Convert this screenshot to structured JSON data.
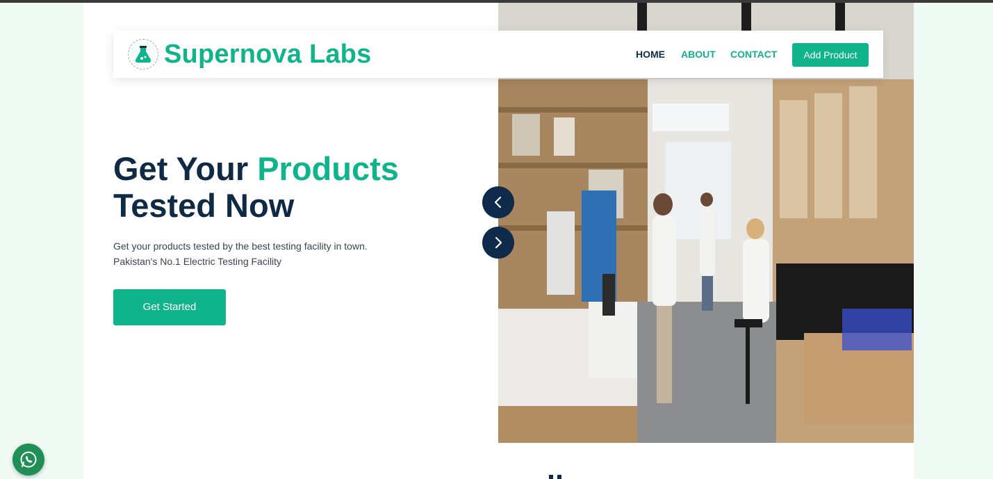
{
  "brand": {
    "name": "Supernova Labs",
    "logo_icon": "flask-logo-icon"
  },
  "nav": {
    "home": "HOME",
    "about": "ABOUT",
    "contact": "CONTACT",
    "add_product": "Add Product"
  },
  "hero": {
    "title_part1": "Get Your ",
    "title_accent": "Products",
    "title_part2": "Tested Now",
    "description_line1": "Get your products tested by the best testing facility in town.",
    "description_line2": "Pakistan's No.1 Electric Testing Facility",
    "cta_label": "Get Started",
    "image_alt": "laboratory-photo"
  },
  "carousel": {
    "prev_icon": "chevron-left-icon",
    "next_icon": "chevron-right-icon"
  },
  "floating": {
    "whatsapp_icon": "whatsapp-icon"
  },
  "colors": {
    "accent": "#10b48a",
    "navy": "#0f2a44",
    "carousel_button": "#102a4c",
    "page_bg": "#eefaf3"
  }
}
